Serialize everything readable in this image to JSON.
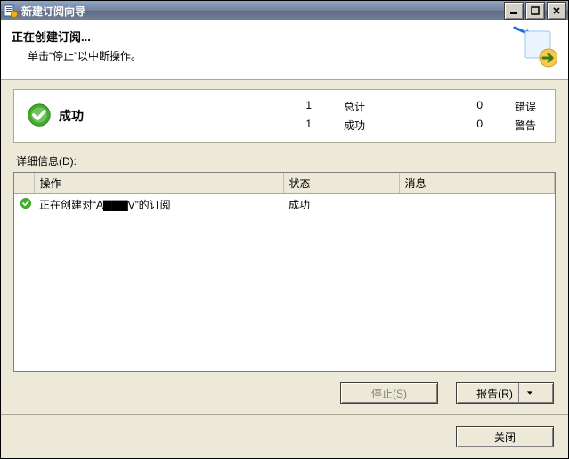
{
  "window": {
    "title": "新建订阅向导"
  },
  "header": {
    "title": "正在创建订阅...",
    "subtitle": "单击“停止”以中断操作。"
  },
  "summary": {
    "status_label": "成功",
    "total_num": "1",
    "total_label": "总计",
    "success_num": "1",
    "success_label": "成功",
    "error_num": "0",
    "error_label": "错误",
    "warning_num": "0",
    "warning_label": "警告"
  },
  "details_label": "详细信息(D):",
  "table": {
    "headers": {
      "action": "操作",
      "status": "状态",
      "message": "消息"
    },
    "rows": [
      {
        "action": "正在创建对“A▇▇▇V”的订阅",
        "status": "成功",
        "message": ""
      }
    ]
  },
  "buttons": {
    "stop": "停止(S)",
    "report": "报告(R)",
    "close": "关闭"
  }
}
